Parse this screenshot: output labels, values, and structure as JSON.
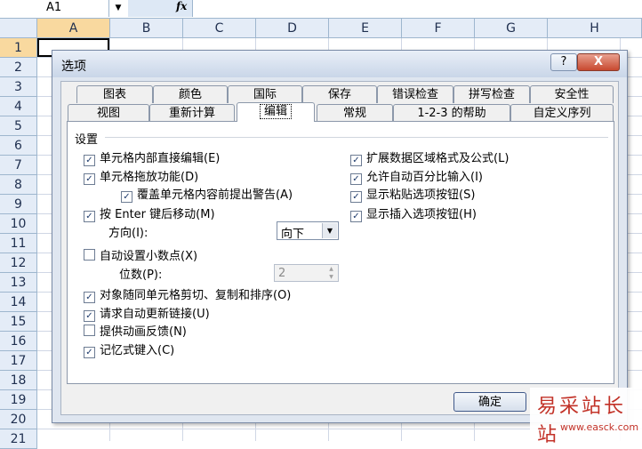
{
  "formula_bar": {
    "name_box": "A1",
    "fx": "fx"
  },
  "columns": [
    "A",
    "B",
    "C",
    "D",
    "E",
    "F",
    "G",
    "H"
  ],
  "rows": [
    "1",
    "2",
    "3",
    "4",
    "5",
    "6",
    "7",
    "8",
    "9",
    "10",
    "11",
    "12",
    "13",
    "14",
    "15",
    "16",
    "17",
    "18",
    "19",
    "20",
    "21"
  ],
  "dialog": {
    "title": "选项",
    "help": "?",
    "close": "X",
    "tabs_row1": [
      "图表",
      "颜色",
      "国际",
      "保存",
      "错误检查",
      "拼写检查",
      "安全性"
    ],
    "tabs_row2": [
      "视图",
      "重新计算",
      "编辑",
      "常规",
      "1-2-3 的帮助",
      "自定义序列"
    ],
    "active_tab": "编辑",
    "section": "设置",
    "options_left": [
      {
        "label": "单元格内部直接编辑(E)",
        "checked": true
      },
      {
        "label": "单元格拖放功能(D)",
        "checked": true
      },
      {
        "label": "覆盖单元格内容前提出警告(A)",
        "checked": true
      },
      {
        "label": "按 Enter 键后移动(M)",
        "checked": true
      },
      {
        "label": "自动设置小数点(X)",
        "checked": false
      },
      {
        "label": "对象随同单元格剪切、复制和排序(O)",
        "checked": true
      },
      {
        "label": "请求自动更新链接(U)",
        "checked": true
      },
      {
        "label": "提供动画反馈(N)",
        "checked": false
      },
      {
        "label": "记忆式键入(C)",
        "checked": true
      }
    ],
    "options_right": [
      {
        "label": "扩展数据区域格式及公式(L)",
        "checked": true
      },
      {
        "label": "允许自动百分比输入(I)",
        "checked": true
      },
      {
        "label": "显示粘贴选项按钮(S)",
        "checked": true
      },
      {
        "label": "显示插入选项按钮(H)",
        "checked": true
      }
    ],
    "direction_label": "方向(I):",
    "direction_value": "向下",
    "places_label": "位数(P):",
    "places_value": "2",
    "ok_label": "确定"
  },
  "watermark": {
    "line1": "易采站长站",
    "line2": "www.easck.com"
  }
}
